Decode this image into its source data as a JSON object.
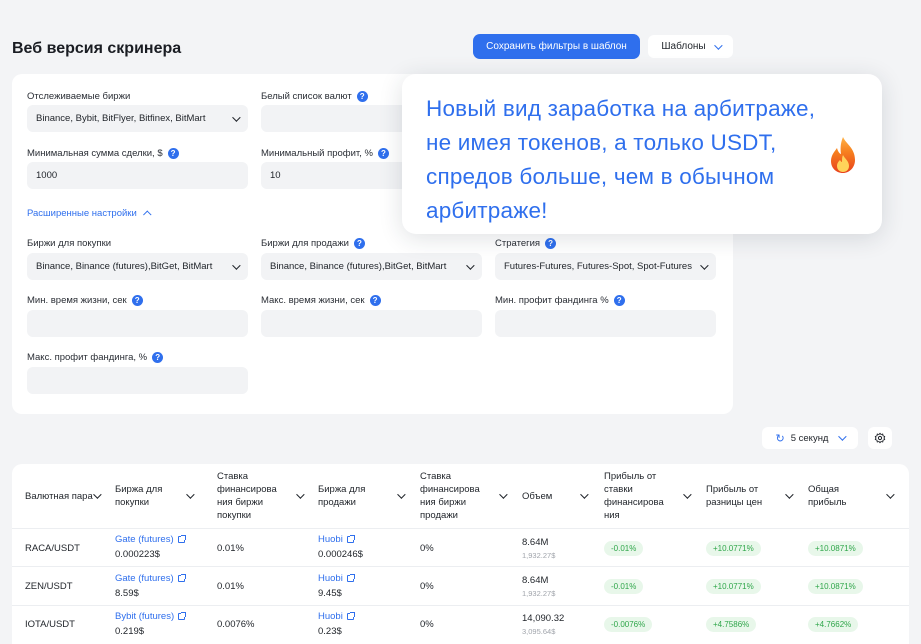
{
  "header": {
    "title": "Веб версия скринера",
    "save_button": "Сохранить фильтры в шаблон",
    "templates_button": "Шаблоны"
  },
  "filters": {
    "tracked_exchanges": {
      "label": "Отслеживаемые биржи",
      "value": "Binance, Bybit, BitFlyer, Bitfinex, BitMart"
    },
    "whitelist": {
      "label": "Белый список валют",
      "value": ""
    },
    "min_deal": {
      "label": "Минимальная сумма сделки, $",
      "value": "1000"
    },
    "min_profit": {
      "label": "Минимальный профит, %",
      "value": "10"
    },
    "advanced_toggle": "Расширенные настройки",
    "buy_exchanges": {
      "label": "Биржи для покупки",
      "value": "Binance, Binance (futures),BitGet, BitMart"
    },
    "sell_exchanges": {
      "label": "Биржи для продажи",
      "value": "Binance, Binance (futures),BitGet, BitMart"
    },
    "strategy": {
      "label": "Стратегия",
      "value": "Futures-Futures, Futures-Spot, Spot-Futures"
    },
    "min_lifetime": {
      "label": "Мин. время жизни, сек",
      "value": ""
    },
    "max_lifetime": {
      "label": "Макс. время жизни, сек",
      "value": ""
    },
    "min_funding": {
      "label": "Мин.  профит фандинга %",
      "value": ""
    },
    "max_funding": {
      "label": "Макс. профит фандинга, %",
      "value": ""
    }
  },
  "popup": {
    "text": "Новый вид заработка на арбитраже, не имея токенов, а только USDT, спредов больше, чем в обычном арбитраже!",
    "icon": "fire-icon"
  },
  "controls": {
    "refresh_interval": "5 секунд",
    "settings_icon": "gear-icon"
  },
  "table": {
    "columns": [
      "Валютная пара",
      "Биржа для покупки",
      "Ставка финансирова ния биржи покупки",
      "Биржа для продажи",
      "Ставка финансирова ния биржи продажи",
      "Объем",
      "Прибыль от ставки финансирова ния",
      "Прибыль от разницы цен",
      "Общая прибыль"
    ],
    "rows": [
      {
        "pair": "RACA/USDT",
        "buy_exchange": "Gate (futures)",
        "buy_price": "0.000223$",
        "buy_rate": "0.01%",
        "sell_exchange": "Huobi",
        "sell_price": "0.000246$",
        "sell_rate": "0%",
        "volume": "8.64M",
        "volume_sub": "1,932.27$",
        "funding_profit": "-0.01%",
        "price_profit": "+10.0771%",
        "total_profit": "+10.0871%"
      },
      {
        "pair": "ZEN/USDT",
        "buy_exchange": "Gate (futures)",
        "buy_price": "8.59$",
        "buy_rate": "0.01%",
        "sell_exchange": "Huobi",
        "sell_price": "9.45$",
        "sell_rate": "0%",
        "volume": "8.64M",
        "volume_sub": "1,932.27$",
        "funding_profit": "-0.01%",
        "price_profit": "+10.0771%",
        "total_profit": "+10.0871%"
      },
      {
        "pair": "IOTA/USDT",
        "buy_exchange": "Bybit (futures)",
        "buy_price": "0.219$",
        "buy_rate": "0.0076%",
        "sell_exchange": "Huobi",
        "sell_price": "0.23$",
        "sell_rate": "0%",
        "volume": "14,090.32",
        "volume_sub": "3,095.64$",
        "funding_profit": "-0.0076%",
        "price_profit": "+4.7586%",
        "total_profit": "+4.7662%"
      }
    ]
  }
}
